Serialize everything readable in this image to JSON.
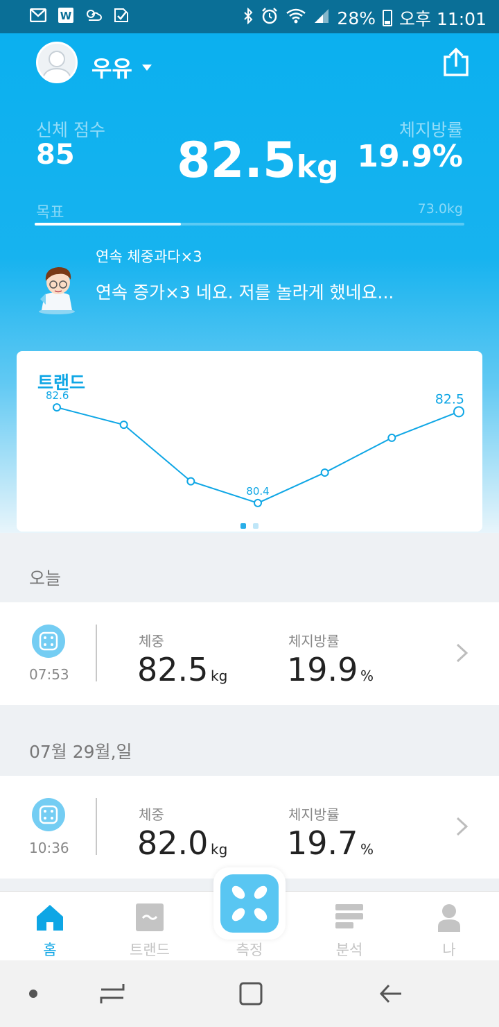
{
  "status_bar": {
    "battery": "28%",
    "time": "오후 11:01",
    "left_icons": [
      "gmail-icon",
      "word-icon",
      "weather-icon",
      "checklist-icon"
    ],
    "right_icons": [
      "bluetooth-icon",
      "alarm-icon",
      "wifi-icon",
      "signal-icon",
      "battery-icon"
    ]
  },
  "header": {
    "username": "우유"
  },
  "summary": {
    "score_label": "신체 점수",
    "score_value": "85",
    "weight_value": "82.5",
    "weight_unit": "kg",
    "bodyfat_label": "체지방률",
    "bodyfat_value": "19.9%",
    "goal_label": "목표",
    "goal_value": "73.0kg",
    "goal_progress_fraction": 0.34
  },
  "tip": {
    "title": "연속 체중과다×3",
    "text": "연속 증가×3 네요. 저를 놀라게 했네요..."
  },
  "trend": {
    "title": "트랜드",
    "page_count": 2,
    "active_page": 0
  },
  "chart_data": {
    "type": "line",
    "values": [
      82.6,
      82.2,
      80.9,
      80.4,
      81.1,
      81.9,
      82.5
    ],
    "labels": [
      "82.6",
      "",
      "",
      "80.4",
      "",
      "",
      "82.5"
    ],
    "ylim": [
      80.0,
      83.0
    ],
    "grid": false
  },
  "sections": [
    {
      "label": "오늘",
      "time": "07:53",
      "weight_label": "체중",
      "weight": "82.5",
      "weight_unit": "kg",
      "fat_label": "체지방률",
      "fat": "19.9",
      "fat_unit": "%"
    },
    {
      "label": "07월 29월,일",
      "time": "10:36",
      "weight_label": "체중",
      "weight": "82.0",
      "weight_unit": "kg",
      "fat_label": "체지방률",
      "fat": "19.7",
      "fat_unit": "%"
    }
  ],
  "nav": {
    "home": "홈",
    "trend": "트랜드",
    "measure": "측정",
    "analysis": "분석",
    "me": "나"
  },
  "colors": {
    "accent": "#0ea6e5",
    "hero_top": "#0bb0ef",
    "status_bar": "#0a6f97"
  }
}
